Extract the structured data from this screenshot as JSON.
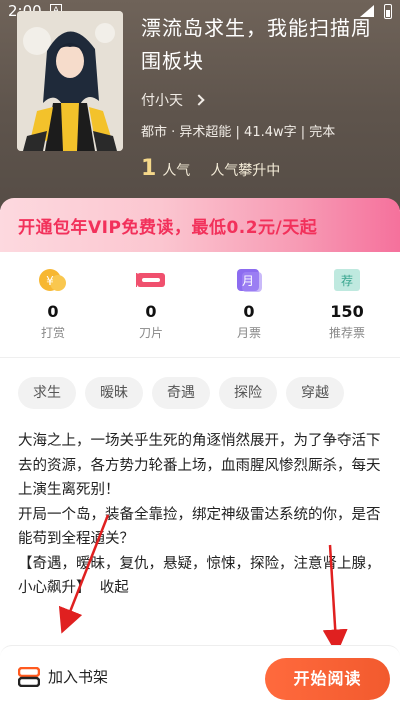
{
  "status_bar": {
    "time": "2:00",
    "a_label": "A"
  },
  "book": {
    "title": "漂流岛求生，我能扫描周围板块",
    "author": "付小天",
    "meta": "都市 · 异术超能 | 41.4w字 | 完本",
    "popularity_num": "1",
    "popularity_label": "人气",
    "popularity_status": "人气攀升中"
  },
  "vip_banner": {
    "text": "开通包年VIP免费读，最低0.2元/天起"
  },
  "stats": [
    {
      "value": "0",
      "label": "打赏",
      "icon": "coin-icon"
    },
    {
      "value": "0",
      "label": "刀片",
      "icon": "blade-icon"
    },
    {
      "value": "0",
      "label": "月票",
      "icon": "month-ticket-icon",
      "icon_text": "月"
    },
    {
      "value": "150",
      "label": "推荐票",
      "icon": "recommend-ticket-icon",
      "icon_text": "荐"
    }
  ],
  "tags": [
    "求生",
    "暧昧",
    "奇遇",
    "探险",
    "穿越"
  ],
  "synopsis": {
    "p1": "大海之上，一场关乎生死的角逐悄然展开，为了争夺活下去的资源，各方势力轮番上场，血雨腥风惨烈厮杀，每天上演生离死别！",
    "p2": "开局一个岛，装备全靠捡，绑定神级雷达系统的你，是否能苟到全程通关？",
    "p3": "【奇遇，暧昧，复仇，悬疑，惊悚，探险，注意肾上腺，小心飙升】",
    "collapse": "收起"
  },
  "bottom_bar": {
    "shelf_label": "加入书架",
    "read_label": "开始阅读"
  },
  "colors": {
    "accent": "#f25a2e",
    "vip_text": "#f2315b"
  }
}
